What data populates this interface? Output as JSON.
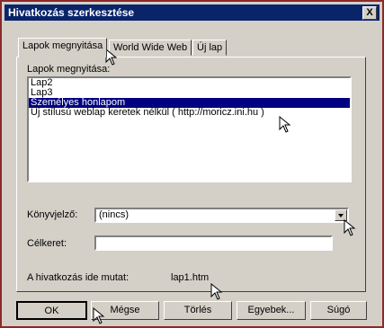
{
  "window": {
    "title": "Hivatkozás szerkesztése",
    "close_label": "X"
  },
  "tabs": [
    {
      "label": "Lapok megnyitása"
    },
    {
      "label": "World Wide Web"
    },
    {
      "label": "Új lap"
    }
  ],
  "list": {
    "label": "Lapok megnyitása:",
    "items": [
      "Lap2",
      "Lap3",
      "Személyes honlapom",
      "Új stílusú weblap keretek nélkül ( http://moricz.ini.hu )"
    ],
    "selected_index": 2
  },
  "bookmark": {
    "label": "Könyvjelző:",
    "value": "(nincs)"
  },
  "target_frame": {
    "label": "Célkeret:",
    "value": ""
  },
  "link_target": {
    "label": "A hivatkozás ide mutat:",
    "value": "lap1.htm"
  },
  "buttons": {
    "ok": "OK",
    "cancel": "Mégse",
    "delete": "Törlés",
    "other": "Egyebek...",
    "help": "Súgó"
  },
  "colors": {
    "titlebar": "#0a246a",
    "selection": "#000080",
    "window_border": "#8a2a2a",
    "face": "#d4d0c8"
  }
}
